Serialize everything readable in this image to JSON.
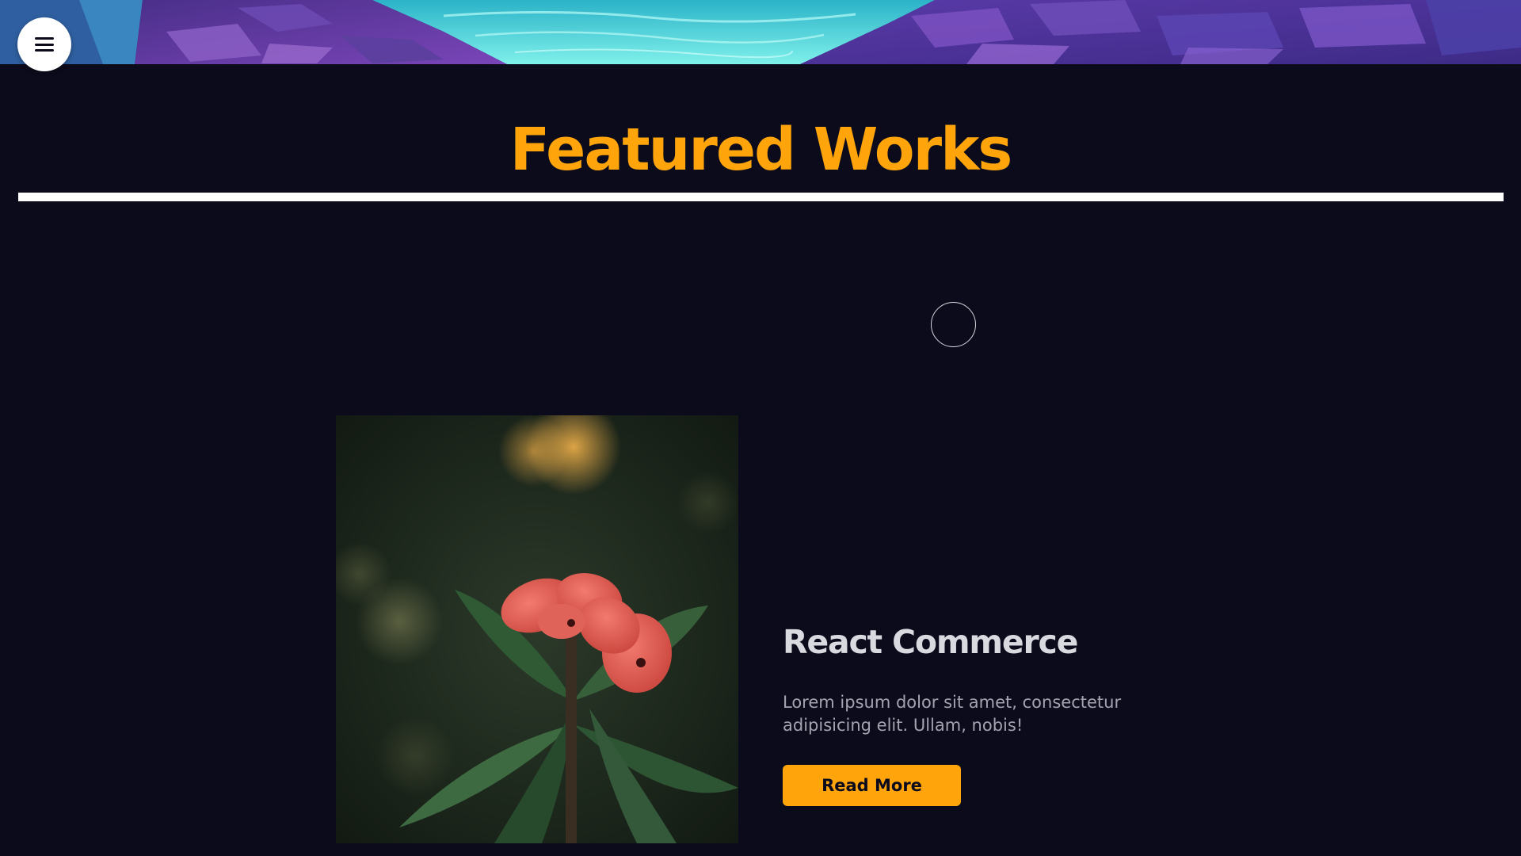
{
  "header": {
    "menu_button_icon": "hamburger-menu-icon",
    "banner_image": "stylized-river-canyon-illustration"
  },
  "featured": {
    "title": "Featured Works"
  },
  "work": {
    "image": "red-flower-photo",
    "title": "React Commerce",
    "description": "Lorem ipsum dolor sit amet, consectetur adipisicing elit. Ullam, nobis!",
    "button_label": "Read More"
  },
  "colors": {
    "background": "#0b0b1c",
    "accent": "#ffa50b",
    "divider": "#ffffff",
    "title_text": "#d9d9e0",
    "body_text": "#a4a4b0"
  }
}
